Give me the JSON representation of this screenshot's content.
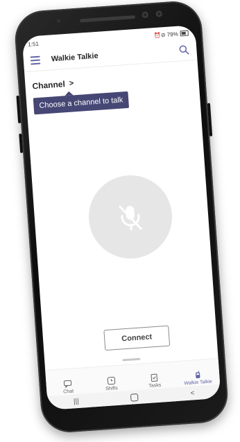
{
  "status": {
    "time": "1:51",
    "right_text": "⏰⊘ 79%"
  },
  "app": {
    "title": "Walkie Talkie"
  },
  "channel": {
    "label": "Channel",
    "chevron": ">"
  },
  "tooltip": {
    "text": "Choose a channel to talk"
  },
  "connect": {
    "label": "Connect"
  },
  "tabs": [
    {
      "label": "Chat",
      "icon": "chat-icon"
    },
    {
      "label": "Shifts",
      "icon": "clock-icon"
    },
    {
      "label": "Tasks",
      "icon": "tasks-icon"
    },
    {
      "label": "Walkie Talkie",
      "icon": "walkie-talkie-icon"
    }
  ],
  "colors": {
    "accent": "#6264a7",
    "tooltip_bg": "#464775",
    "mic_circle": "#e6e6e6"
  }
}
